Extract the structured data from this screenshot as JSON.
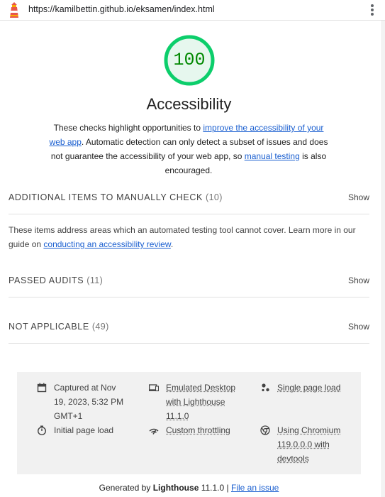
{
  "browser": {
    "url": "https://kamilbettin.github.io/eksamen/index.html",
    "logo_icon": "lighthouse-icon",
    "menu_icon": "kebab-menu-icon"
  },
  "category": {
    "score": "100",
    "score_fraction": 1.0,
    "score_color": "#0cce6b",
    "score_text_color": "#008800",
    "title": "Accessibility",
    "description": {
      "p1": "These checks highlight opportunities to ",
      "link1": "improve the accessibility of your web app",
      "p2": ". Automatic detection can only detect a subset of issues and does not guarantee the accessibility of your web app, so ",
      "link2": "manual testing",
      "p3": " is also encouraged."
    }
  },
  "sections": [
    {
      "title": "ADDITIONAL ITEMS TO MANUALLY CHECK",
      "count": "(10)",
      "toggle": "Show",
      "description": {
        "p1": "These items address areas which an automated testing tool cannot cover. Learn more in our guide on ",
        "link": "conducting an accessibility review",
        "p2": "."
      }
    },
    {
      "title": "PASSED AUDITS",
      "count": "(11)",
      "toggle": "Show"
    },
    {
      "title": "NOT APPLICABLE",
      "count": "(49)",
      "toggle": "Show"
    }
  ],
  "env": [
    {
      "icon": "calendar-icon",
      "lines": [
        "Captured at Nov",
        "19, 2023, 5:32 PM",
        "GMT+1"
      ]
    },
    {
      "icon": "desktop-icon",
      "lines": [
        "Emulated Desktop",
        "with Lighthouse",
        "11.1.0"
      ]
    },
    {
      "icon": "single-page-icon",
      "lines": [
        "Single page load"
      ]
    },
    {
      "icon": "stopwatch-icon",
      "lines": [
        "Initial page load"
      ]
    },
    {
      "icon": "throttling-icon",
      "lines": [
        "Custom throttling"
      ]
    },
    {
      "icon": "chromium-icon",
      "lines": [
        "Using Chromium",
        "119.0.0.0 with",
        "devtools"
      ]
    }
  ],
  "footer": {
    "generated_by": "Generated by ",
    "product": "Lighthouse",
    "version": " 11.1.0 | ",
    "file_issue": "File an issue"
  }
}
